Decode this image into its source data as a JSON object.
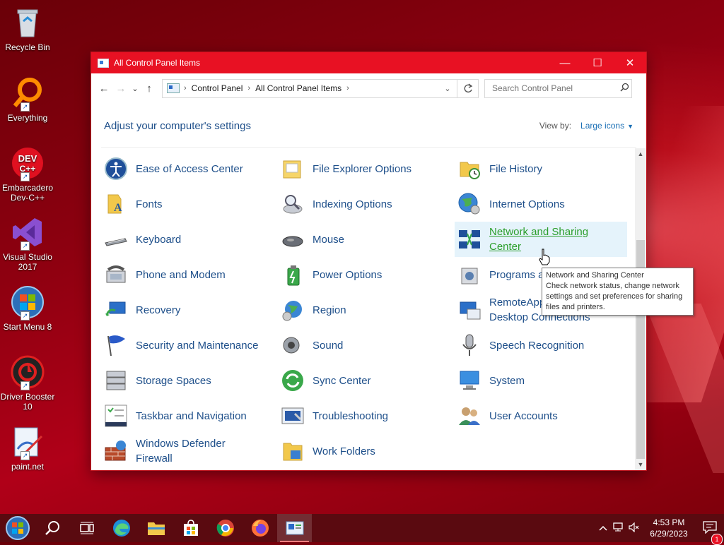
{
  "desktop": {
    "icons": [
      {
        "label": "Recycle Bin",
        "icon": "recycle-bin-icon"
      },
      {
        "label": "Everything",
        "icon": "everything-search-icon"
      },
      {
        "label": "Embarcadero Dev-C++",
        "icon": "devcpp-icon"
      },
      {
        "label": "Visual Studio 2017",
        "icon": "visual-studio-icon"
      },
      {
        "label": "Start Menu 8",
        "icon": "windows-orb-icon"
      },
      {
        "label": "Driver Booster 10",
        "icon": "driver-booster-icon"
      },
      {
        "label": "paint.net",
        "icon": "paintnet-icon"
      }
    ]
  },
  "window": {
    "title": "All Control Panel Items",
    "accent": "#e81123",
    "controls": {
      "minimize": "—",
      "maximize": "☐",
      "close": "✕"
    },
    "nav": {
      "back": "←",
      "forward": "→",
      "recent": "⌄",
      "up": "↑"
    },
    "breadcrumb": [
      "Control Panel",
      "All Control Panel Items"
    ],
    "search_placeholder": "Search Control Panel",
    "heading": "Adjust your computer's settings",
    "view_by_label": "View by:",
    "view_by_value": "Large icons",
    "items": [
      {
        "label": "Ease of Access Center",
        "icon": "ease-of-access-icon"
      },
      {
        "label": "File Explorer Options",
        "icon": "folder-options-icon"
      },
      {
        "label": "File History",
        "icon": "file-history-icon"
      },
      {
        "label": "Fonts",
        "icon": "fonts-icon"
      },
      {
        "label": "Indexing Options",
        "icon": "indexing-icon"
      },
      {
        "label": "Internet Options",
        "icon": "internet-options-icon"
      },
      {
        "label": "Keyboard",
        "icon": "keyboard-icon"
      },
      {
        "label": "Mouse",
        "icon": "mouse-icon"
      },
      {
        "label": "Network and Sharing Center",
        "icon": "network-icon"
      },
      {
        "label": "Phone and Modem",
        "icon": "phone-icon"
      },
      {
        "label": "Power Options",
        "icon": "power-icon"
      },
      {
        "label": "Programs and Features",
        "icon": "programs-icon"
      },
      {
        "label": "Recovery",
        "icon": "recovery-icon"
      },
      {
        "label": "Region",
        "icon": "region-icon"
      },
      {
        "label": "RemoteApp and Desktop Connections",
        "icon": "remoteapp-icon"
      },
      {
        "label": "Security and Maintenance",
        "icon": "security-flag-icon"
      },
      {
        "label": "Sound",
        "icon": "sound-icon"
      },
      {
        "label": "Speech Recognition",
        "icon": "microphone-icon"
      },
      {
        "label": "Storage Spaces",
        "icon": "storage-icon"
      },
      {
        "label": "Sync Center",
        "icon": "sync-icon"
      },
      {
        "label": "System",
        "icon": "system-icon"
      },
      {
        "label": "Taskbar and Navigation",
        "icon": "taskbar-icon"
      },
      {
        "label": "Troubleshooting",
        "icon": "troubleshooting-icon"
      },
      {
        "label": "User Accounts",
        "icon": "user-accounts-icon"
      },
      {
        "label": "Windows Defender Firewall",
        "icon": "firewall-icon"
      },
      {
        "label": "Work Folders",
        "icon": "work-folders-icon"
      }
    ],
    "tooltip": {
      "title": "Network and Sharing Center",
      "body": "Check network status, change network settings and set preferences for sharing files and printers."
    }
  },
  "taskbar": {
    "apps": [
      "start-orb-icon",
      "search-icon",
      "task-view-icon",
      "edge-icon",
      "file-explorer-icon",
      "store-icon",
      "chrome-icon",
      "firefox-icon",
      "control-panel-icon"
    ],
    "time": "4:53 PM",
    "date": "6/29/2023",
    "notification_count": "1"
  }
}
